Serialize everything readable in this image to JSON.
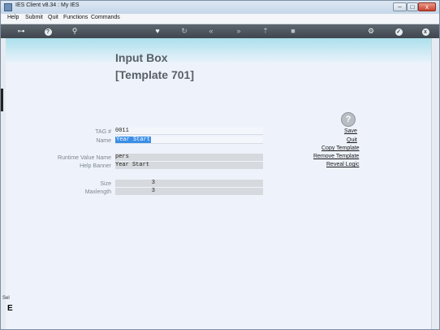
{
  "window": {
    "title": "IES Client v8.34 : My IES",
    "minimize": "–",
    "maximize": "□",
    "close": "x"
  },
  "menu": [
    "Help",
    "Submit",
    "Quit",
    "Functions",
    "Commands"
  ],
  "toolbar": {
    "key": "⊶",
    "help": "?",
    "search": "⚲",
    "heart": "♥",
    "refresh": "↻",
    "back": "«",
    "forward": "»",
    "upload": "⇡",
    "stop": "■",
    "gear": "⚙",
    "ok": "✓",
    "cancel": "x"
  },
  "page": {
    "title": "Input Box",
    "subtitle": "[Template 701]"
  },
  "fields": {
    "tag": {
      "label": "TAG #",
      "value": "0011"
    },
    "name": {
      "label": "Name",
      "value": "Year Start"
    },
    "runtime": {
      "label": "Runtime Value Name",
      "value": "pers"
    },
    "banner": {
      "label": "Help Banner",
      "value": "Year Start"
    },
    "size": {
      "label": "Size",
      "value": "3"
    },
    "maxlength": {
      "label": "Maxlength",
      "value": "3"
    }
  },
  "help_icon": "?",
  "actions": {
    "save": "Save",
    "quit": "Quit",
    "copy": "Copy Template",
    "remove": "Remove Template",
    "reveal": "Reveal Logic"
  },
  "sidebar": {
    "label": "Sel",
    "letter": "E"
  }
}
